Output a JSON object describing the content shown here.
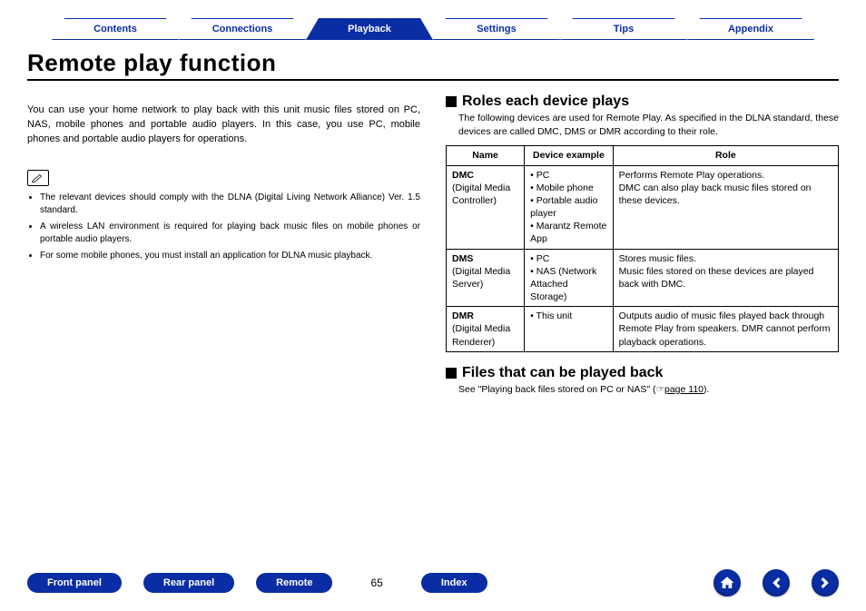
{
  "nav": {
    "tabs": [
      "Contents",
      "Connections",
      "Playback",
      "Settings",
      "Tips",
      "Appendix"
    ],
    "active": 2
  },
  "title": "Remote play function",
  "intro": "You can use your home network to play back with this unit music files stored on PC, NAS, mobile phones and portable audio players. In this case, you use PC, mobile phones and portable audio players for operations.",
  "notes": [
    "The relevant devices should comply with the DLNA (Digital Living Network Alliance) Ver. 1.5 standard.",
    "A wireless LAN environment is required for playing back music files on mobile phones or portable audio players.",
    "For some mobile phones, you must install an application for DLNA music playback."
  ],
  "section1": {
    "heading": "Roles each device plays",
    "sub": "The following devices are used for Remote Play. As specified in the DLNA standard, these devices are called DMC, DMS or DMR according to their role.",
    "cols": [
      "Name",
      "Device example",
      "Role"
    ],
    "rows": [
      {
        "name_bold": "DMC",
        "name_sub": "(Digital Media Controller)",
        "ex": [
          "PC",
          "Mobile phone",
          "Portable audio player",
          "Marantz Remote App"
        ],
        "role": "Performs Remote Play operations.\nDMC can also play back music files stored on these devices."
      },
      {
        "name_bold": "DMS",
        "name_sub": "(Digital Media Server)",
        "ex": [
          "PC",
          "NAS (Network Attached Storage)"
        ],
        "role": "Stores music files.\nMusic files stored on these devices are played back with DMC."
      },
      {
        "name_bold": "DMR",
        "name_sub": "(Digital Media Renderer)",
        "ex": [
          "This unit"
        ],
        "role": "Outputs audio of music files played back through Remote Play from speakers. DMR cannot perform playback operations."
      }
    ]
  },
  "section2": {
    "heading": "Files that can be played back",
    "text_pre": "See \"Playing back files stored on PC or NAS\" (",
    "pointer": "☞",
    "link": "page 110",
    "text_post": ")."
  },
  "footer": {
    "pills": [
      "Front panel",
      "Rear panel",
      "Remote"
    ],
    "page": "65",
    "index_pill": "Index"
  }
}
